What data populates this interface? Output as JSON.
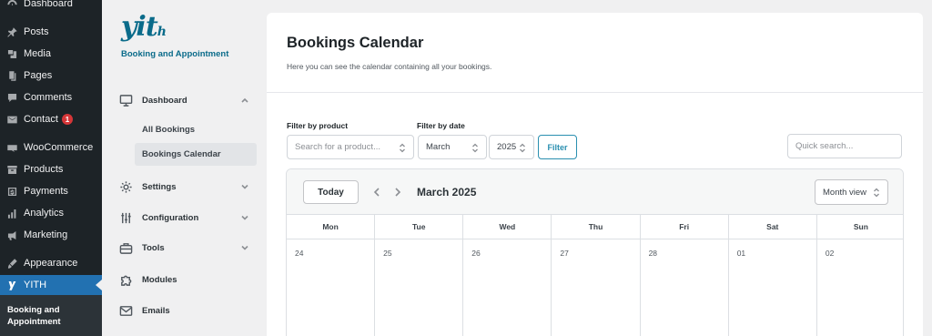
{
  "wp_menu": {
    "items": [
      {
        "label": "Dashboard",
        "icon": "dashboard-icon"
      },
      {
        "label": "Posts",
        "icon": "pin-icon"
      },
      {
        "label": "Media",
        "icon": "media-icon"
      },
      {
        "label": "Pages",
        "icon": "pages-icon"
      },
      {
        "label": "Comments",
        "icon": "comment-icon"
      },
      {
        "label": "Contact",
        "icon": "mail-icon",
        "badge": "1"
      },
      {
        "label": "WooCommerce",
        "icon": "woocommerce-icon"
      },
      {
        "label": "Products",
        "icon": "archive-icon"
      },
      {
        "label": "Payments",
        "icon": "payment-icon"
      },
      {
        "label": "Analytics",
        "icon": "chart-bar-icon"
      },
      {
        "label": "Marketing",
        "icon": "megaphone-icon"
      },
      {
        "label": "Appearance",
        "icon": "brush-icon"
      },
      {
        "label": "YITH",
        "icon": "yith-icon",
        "active": true
      }
    ],
    "submenu_label": "Booking and Appointment",
    "badge_color": "#d63638",
    "active_color": "#2271b1"
  },
  "plugin": {
    "logo": "yith",
    "subtitle": "Booking and Appointment",
    "nav": {
      "dashboard": "Dashboard",
      "all_bookings": "All Bookings",
      "bookings_calendar": "Bookings Calendar",
      "settings": "Settings",
      "configuration": "Configuration",
      "tools": "Tools",
      "modules": "Modules",
      "emails": "Emails"
    },
    "accent_color": "#0a6b8a"
  },
  "page": {
    "title": "Bookings Calendar",
    "description": "Here you can see the calendar containing all your bookings."
  },
  "filters": {
    "product_label": "Filter by product",
    "product_placeholder": "Search for a product...",
    "date_label": "Filter by date",
    "month_value": "March",
    "year_value": "2025",
    "filter_button": "Filter",
    "quick_search_placeholder": "Quick search..."
  },
  "calendar": {
    "today_label": "Today",
    "title": "March 2025",
    "view_label": "Month view",
    "weekdays": [
      "Mon",
      "Tue",
      "Wed",
      "Thu",
      "Fri",
      "Sat",
      "Sun"
    ],
    "first_week": [
      "24",
      "25",
      "26",
      "27",
      "28",
      "01",
      "02"
    ]
  }
}
